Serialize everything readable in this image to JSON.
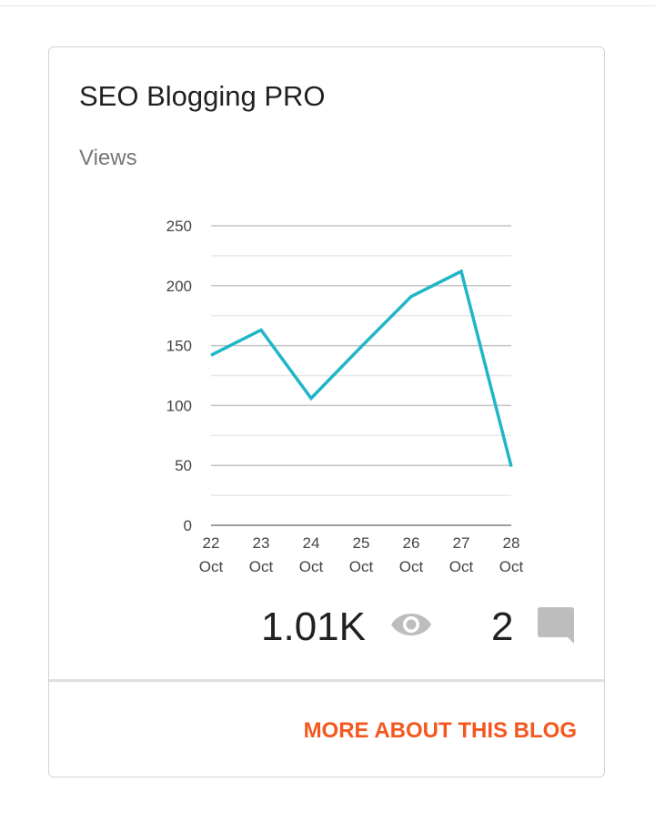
{
  "card": {
    "title": "SEO Blogging PRO",
    "subtitle": "Views",
    "views_count": "1.01K",
    "views_icon": "eye-icon",
    "comments_count": "2",
    "comments_icon": "comment-icon",
    "more_label": "MORE ABOUT THIS BLOG",
    "accent_color": "#f4581f"
  },
  "chart_data": {
    "type": "line",
    "title": "Views",
    "categories": [
      "22 Oct",
      "23 Oct",
      "24 Oct",
      "25 Oct",
      "26 Oct",
      "27 Oct",
      "28 Oct"
    ],
    "series": [
      {
        "values": [
          142,
          163,
          106,
          149,
          191,
          212,
          49
        ],
        "color": "#1fb6c8"
      }
    ],
    "yticks": [
      0,
      50,
      100,
      150,
      200,
      250
    ],
    "ylim": [
      0,
      250
    ],
    "grid": true,
    "legend": "none"
  }
}
